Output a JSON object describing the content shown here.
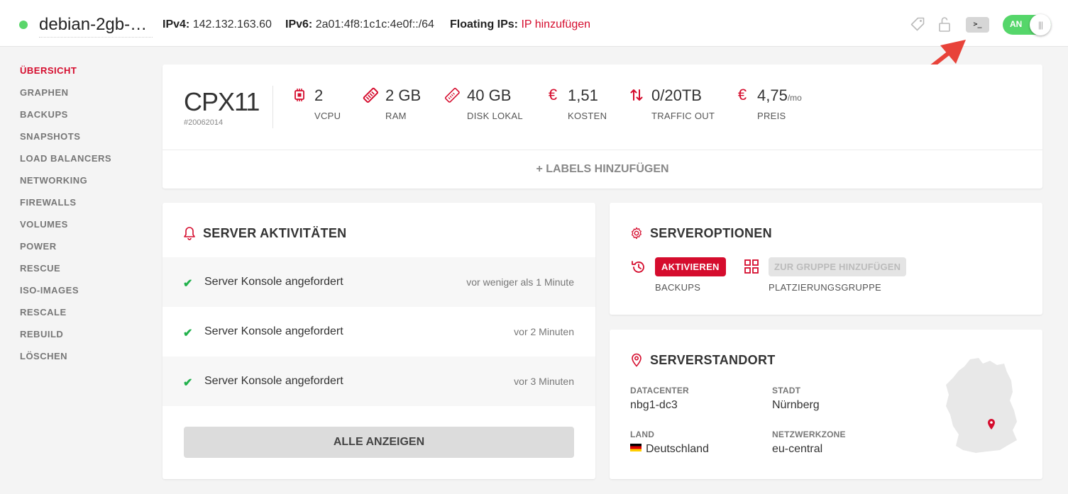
{
  "header": {
    "server_name": "debian-2gb-n...",
    "ipv4_label": "IPv4:",
    "ipv4_value": "142.132.163.60",
    "ipv6_label": "IPv6:",
    "ipv6_value": "2a01:4f8:1c1c:4e0f::/64",
    "floating_label": "Floating IPs:",
    "floating_link": "IP hinzufügen",
    "console_label": ">_",
    "power_label": "AN",
    "power_knob": "|||",
    "icons": [
      "tag-icon",
      "lock-icon",
      "console-icon",
      "power-toggle"
    ]
  },
  "sidebar": {
    "items": [
      {
        "label": "ÜBERSICHT",
        "active": true
      },
      {
        "label": "GRAPHEN"
      },
      {
        "label": "BACKUPS"
      },
      {
        "label": "SNAPSHOTS"
      },
      {
        "label": "LOAD BALANCERS"
      },
      {
        "label": "NETWORKING"
      },
      {
        "label": "FIREWALLS"
      },
      {
        "label": "VOLUMES"
      },
      {
        "label": "POWER"
      },
      {
        "label": "RESCUE"
      },
      {
        "label": "ISO-IMAGES"
      },
      {
        "label": "RESCALE"
      },
      {
        "label": "REBUILD"
      },
      {
        "label": "LÖSCHEN"
      }
    ]
  },
  "plan": {
    "name": "CPX11",
    "id": "#20062014",
    "specs": [
      {
        "value": "2",
        "label": "VCPU",
        "icon": "cpu-icon"
      },
      {
        "value": "2 GB",
        "label": "RAM",
        "icon": "ram-icon"
      },
      {
        "value": "40 GB",
        "label": "DISK LOKAL",
        "icon": "disk-icon"
      },
      {
        "value": "1,51",
        "label": "KOSTEN",
        "icon": "euro-icon"
      },
      {
        "value": "0/20TB",
        "label": "TRAFFIC OUT",
        "icon": "traffic-icon"
      },
      {
        "value": "4,75",
        "unit": "/mo",
        "label": "PREIS",
        "icon": "euro-icon"
      }
    ],
    "add_labels": "+ LABELS HINZUFÜGEN"
  },
  "activities": {
    "title": "SERVER AKTIVITÄTEN",
    "items": [
      {
        "text": "Server Konsole angefordert",
        "time": "vor weniger als 1 Minute"
      },
      {
        "text": "Server Konsole angefordert",
        "time": "vor 2 Minuten"
      },
      {
        "text": "Server Konsole angefordert",
        "time": "vor 3 Minuten"
      }
    ],
    "show_all": "ALLE ANZEIGEN"
  },
  "options": {
    "title": "SERVEROPTIONEN",
    "backups_button": "AKTIVIEREN",
    "backups_label": "BACKUPS",
    "group_button": "ZUR GRUPPE HINZUFÜGEN",
    "group_label": "PLATZIERUNGSGRUPPE"
  },
  "location": {
    "title": "SERVERSTANDORT",
    "datacenter_label": "DATACENTER",
    "datacenter": "nbg1-dc3",
    "city_label": "STADT",
    "city": "Nürnberg",
    "country_label": "LAND",
    "country": "Deutschland",
    "zone_label": "NETZWERKZONE",
    "zone": "eu-central"
  },
  "colors": {
    "accent": "#d50c2d",
    "status_green": "#5ad66a",
    "check_green": "#22b14c",
    "annotation_arrow": "#e8433a"
  }
}
